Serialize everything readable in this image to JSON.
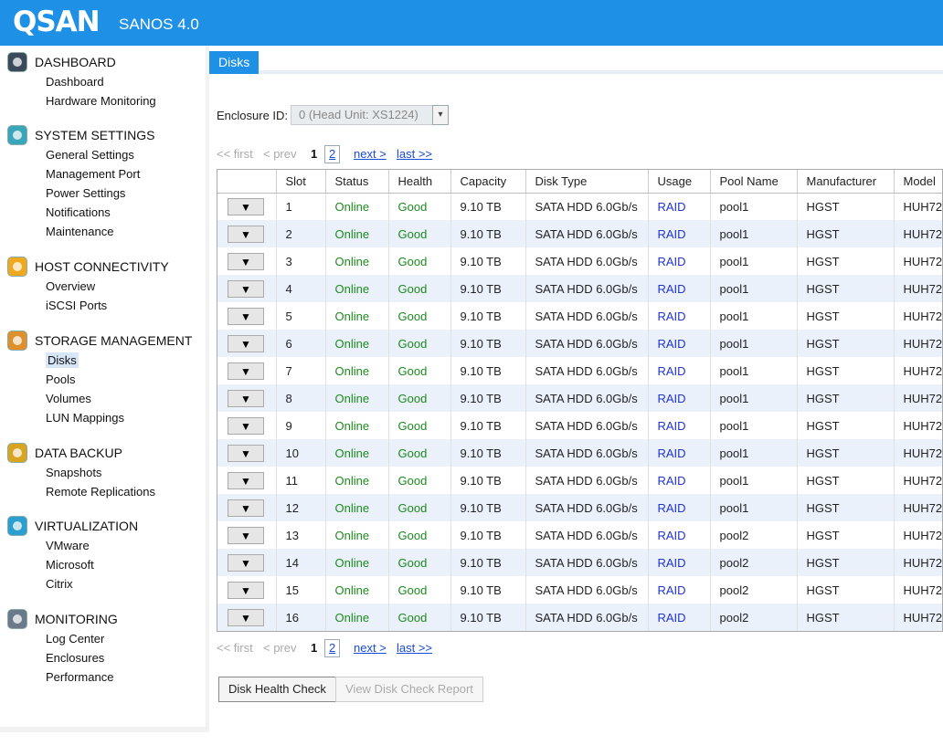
{
  "header": {
    "logo": "QSAN",
    "product": "SANOS 4.0",
    "colors": {
      "bar": "#1e90e6",
      "accent": "#7fd64a"
    }
  },
  "sidebar": [
    {
      "title": "DASHBOARD",
      "icon": "dashboard-chart-icon",
      "color": "#3a4a5a",
      "items": [
        "Dashboard",
        "Hardware Monitoring"
      ]
    },
    {
      "title": "SYSTEM SETTINGS",
      "icon": "system-settings-icon",
      "color": "#3aa6b9",
      "items": [
        "General Settings",
        "Management Port",
        "Power Settings",
        "Notifications",
        "Maintenance"
      ]
    },
    {
      "title": "HOST CONNECTIVITY",
      "icon": "host-connectivity-icon",
      "color": "#f0a81e",
      "items": [
        "Overview",
        "iSCSI Ports"
      ]
    },
    {
      "title": "STORAGE MANAGEMENT",
      "icon": "storage-management-icon",
      "color": "#e0902a",
      "items": [
        "Disks",
        "Pools",
        "Volumes",
        "LUN Mappings"
      ]
    },
    {
      "title": "DATA BACKUP",
      "icon": "data-backup-icon",
      "color": "#d9a520",
      "items": [
        "Snapshots",
        "Remote Replications"
      ]
    },
    {
      "title": "VIRTUALIZATION",
      "icon": "virtualization-icon",
      "color": "#2a9fd0",
      "items": [
        "VMware",
        "Microsoft",
        "Citrix"
      ]
    },
    {
      "title": "MONITORING",
      "icon": "monitoring-icon",
      "color": "#6a7a8a",
      "items": [
        "Log Center",
        "Enclosures",
        "Performance"
      ]
    }
  ],
  "selected_item": "Disks",
  "main": {
    "tab": "Disks",
    "enclosure_label": "Enclosure ID:",
    "enclosure_value": "0 (Head Unit: XS1224)",
    "pager": {
      "first": "<< first",
      "prev": "< prev",
      "page1": "1",
      "page2": "2",
      "next": "next >",
      "last": "last >>"
    },
    "columns": [
      "",
      "Slot",
      "Status",
      "Health",
      "Capacity",
      "Disk Type",
      "Usage",
      "Pool Name",
      "Manufacturer",
      "Model"
    ],
    "rows": [
      [
        "▼",
        "1",
        "Online",
        "Good",
        "9.10 TB",
        "SATA HDD 6.0Gb/s",
        "RAID",
        "pool1",
        "HGST",
        "HUH72"
      ],
      [
        "▼",
        "2",
        "Online",
        "Good",
        "9.10 TB",
        "SATA HDD 6.0Gb/s",
        "RAID",
        "pool1",
        "HGST",
        "HUH72"
      ],
      [
        "▼",
        "3",
        "Online",
        "Good",
        "9.10 TB",
        "SATA HDD 6.0Gb/s",
        "RAID",
        "pool1",
        "HGST",
        "HUH72"
      ],
      [
        "▼",
        "4",
        "Online",
        "Good",
        "9.10 TB",
        "SATA HDD 6.0Gb/s",
        "RAID",
        "pool1",
        "HGST",
        "HUH72"
      ],
      [
        "▼",
        "5",
        "Online",
        "Good",
        "9.10 TB",
        "SATA HDD 6.0Gb/s",
        "RAID",
        "pool1",
        "HGST",
        "HUH72"
      ],
      [
        "▼",
        "6",
        "Online",
        "Good",
        "9.10 TB",
        "SATA HDD 6.0Gb/s",
        "RAID",
        "pool1",
        "HGST",
        "HUH72"
      ],
      [
        "▼",
        "7",
        "Online",
        "Good",
        "9.10 TB",
        "SATA HDD 6.0Gb/s",
        "RAID",
        "pool1",
        "HGST",
        "HUH72"
      ],
      [
        "▼",
        "8",
        "Online",
        "Good",
        "9.10 TB",
        "SATA HDD 6.0Gb/s",
        "RAID",
        "pool1",
        "HGST",
        "HUH72"
      ],
      [
        "▼",
        "9",
        "Online",
        "Good",
        "9.10 TB",
        "SATA HDD 6.0Gb/s",
        "RAID",
        "pool1",
        "HGST",
        "HUH72"
      ],
      [
        "▼",
        "10",
        "Online",
        "Good",
        "9.10 TB",
        "SATA HDD 6.0Gb/s",
        "RAID",
        "pool1",
        "HGST",
        "HUH72"
      ],
      [
        "▼",
        "11",
        "Online",
        "Good",
        "9.10 TB",
        "SATA HDD 6.0Gb/s",
        "RAID",
        "pool1",
        "HGST",
        "HUH72"
      ],
      [
        "▼",
        "12",
        "Online",
        "Good",
        "9.10 TB",
        "SATA HDD 6.0Gb/s",
        "RAID",
        "pool1",
        "HGST",
        "HUH72"
      ],
      [
        "▼",
        "13",
        "Online",
        "Good",
        "9.10 TB",
        "SATA HDD 6.0Gb/s",
        "RAID",
        "pool2",
        "HGST",
        "HUH72"
      ],
      [
        "▼",
        "14",
        "Online",
        "Good",
        "9.10 TB",
        "SATA HDD 6.0Gb/s",
        "RAID",
        "pool2",
        "HGST",
        "HUH72"
      ],
      [
        "▼",
        "15",
        "Online",
        "Good",
        "9.10 TB",
        "SATA HDD 6.0Gb/s",
        "RAID",
        "pool2",
        "HGST",
        "HUH72"
      ],
      [
        "▼",
        "16",
        "Online",
        "Good",
        "9.10 TB",
        "SATA HDD 6.0Gb/s",
        "RAID",
        "pool2",
        "HGST",
        "HUH72"
      ]
    ],
    "buttons": {
      "health_check": "Disk Health Check",
      "view_report": "View Disk Check Report"
    }
  }
}
